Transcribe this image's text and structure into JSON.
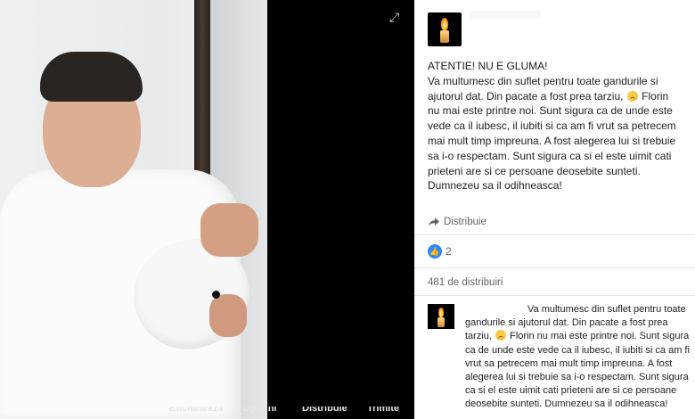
{
  "viewer": {
    "expand_icon": "expand-icon",
    "bottom_actions": [
      "Etichetează",
      "Opțiuni",
      "Distribuie",
      "Trimite"
    ]
  },
  "post": {
    "text_lines": [
      "ATENTIE! NU E GLUMA!",
      "Va multumesc din suflet pentru toate gandurile si",
      "ajutorul dat. Din pacate a fost prea tarziu,",
      "Florin",
      "nu mai este printre noi. Sunt sigura ca de unde este",
      "vede ca il iubesc, il iubiti si ca am fi vrut sa petrecem",
      "mai mult timp impreuna. A fost alegerea lui si trebuie",
      "sa i-o respectam. Sunt sigura ca si el este uimit cati",
      "prieteni are si ce persoane deosebite sunteti.",
      "Dumnezeu sa il odihneasca!"
    ],
    "share_label": "Distribuie",
    "like_count": "2",
    "shares_label": "481 de distribuiri"
  },
  "comment": {
    "lines": [
      "Va multumesc din suflet pentru toate",
      "gandurile si ajutorul dat. Din pacate a fost prea",
      "tarziu,",
      "Florin nu mai este printre noi. Sunt sigura",
      "ca de unde este vede ca il iubesc, il iubiti si ca am fi",
      "vrut sa petrecem mai mult timp impreuna. A fost",
      "alegerea lui si trebuie sa i-o respectam. Sunt sigura",
      "ca si el este uimit cati prieteni are si ce persoane",
      "deosebite sunteti. Dumnezeu sa il odihneasca!"
    ]
  }
}
